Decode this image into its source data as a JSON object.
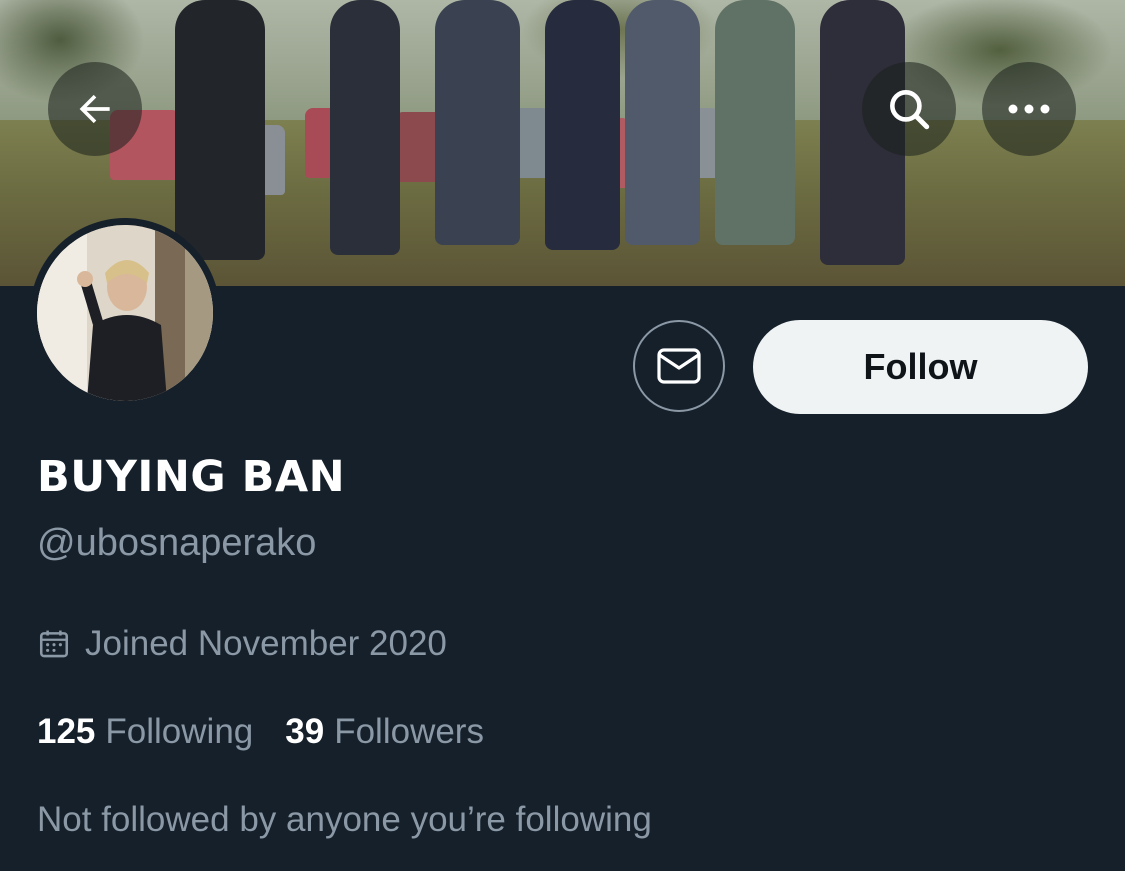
{
  "header": {
    "back_icon": "arrow-left-icon",
    "search_icon": "search-icon",
    "more_icon": "more-horizontal-icon"
  },
  "profile": {
    "display_name": "BUYING BAN",
    "handle": "@ubosnaperako",
    "joined": "Joined November 2020",
    "following_count": "125",
    "following_label": "Following",
    "followers_count": "39",
    "followers_label": "Followers",
    "social_context": "Not followed by anyone you’re following"
  },
  "actions": {
    "message_icon": "mail-icon",
    "follow_label": "Follow"
  },
  "colors": {
    "background": "#15202b",
    "primary_text": "#ffffff",
    "secondary_text": "#8b98a5",
    "follow_button_bg": "#eff3f4",
    "follow_button_text": "#0f1419"
  }
}
